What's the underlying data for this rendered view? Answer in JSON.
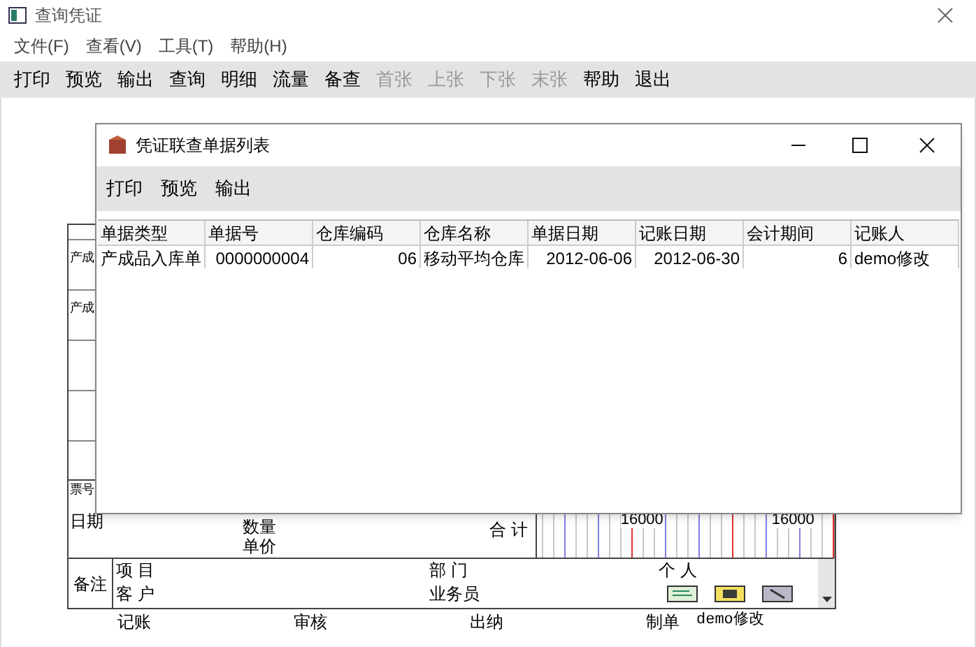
{
  "window": {
    "title": "查询凭证"
  },
  "menu": [
    "文件(F)",
    "查看(V)",
    "工具(T)",
    "帮助(H)"
  ],
  "toolbar": [
    {
      "label": "打印",
      "disabled": false
    },
    {
      "label": "预览",
      "disabled": false
    },
    {
      "label": "输出",
      "disabled": false
    },
    {
      "label": "查询",
      "disabled": false
    },
    {
      "label": "明细",
      "disabled": false
    },
    {
      "label": "流量",
      "disabled": false
    },
    {
      "label": "备查",
      "disabled": false
    },
    {
      "label": "首张",
      "disabled": true
    },
    {
      "label": "上张",
      "disabled": true
    },
    {
      "label": "下张",
      "disabled": true
    },
    {
      "label": "末张",
      "disabled": true
    },
    {
      "label": "帮助",
      "disabled": false
    },
    {
      "label": "退出",
      "disabled": false
    }
  ],
  "voucher": {
    "row_labels": [
      "产成",
      "产成"
    ],
    "ticket_label": "票号",
    "date_label": "日期",
    "quantity_label": "数量",
    "price_label": "单价",
    "total_label": "合 计",
    "debit_total": "16000",
    "credit_total": "16000",
    "notes_label": "备注",
    "project_label": "项 目",
    "customer_label": "客 户",
    "department_label": "部 门",
    "salesperson_label": "业务员",
    "person_label": "个 人",
    "signatures": [
      {
        "label": "记账"
      },
      {
        "label": "审核"
      },
      {
        "label": "出纳"
      },
      {
        "label": "制单",
        "name": "demo修改"
      }
    ]
  },
  "dialog": {
    "title": "凭证联查单据列表",
    "toolbar": [
      "打印",
      "预览",
      "输出"
    ],
    "columns": [
      {
        "label": "单据类型",
        "kind": "text"
      },
      {
        "label": "单据号",
        "kind": "number"
      },
      {
        "label": "仓库编码",
        "kind": "number"
      },
      {
        "label": "仓库名称",
        "kind": "text"
      },
      {
        "label": "单据日期",
        "kind": "number"
      },
      {
        "label": "记账日期",
        "kind": "number"
      },
      {
        "label": "会计期间",
        "kind": "number"
      },
      {
        "label": "记账人",
        "kind": "text"
      }
    ],
    "rows": [
      {
        "cells": [
          "产成品入库单",
          "0000000004",
          "06",
          "移动平均仓库",
          "2012-06-06",
          "2012-06-30",
          "6",
          "demo修改"
        ]
      }
    ]
  }
}
